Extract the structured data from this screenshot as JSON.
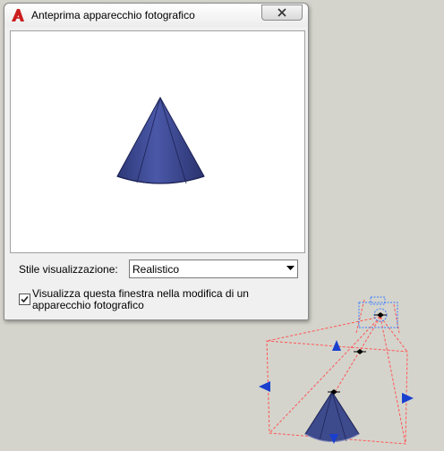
{
  "dialog": {
    "title": "Anteprima apparecchio fotografico",
    "style_label": "Stile visualizzazione:",
    "style_value": "Realistico",
    "checkbox_label": "Visualizza questa finestra nella modifica di un apparecchio fotografico",
    "checkbox_checked": true
  },
  "colors": {
    "cone": "#3d4a8c",
    "camera_frustum": "#ff5555",
    "camera_glyph": "#3a7bff",
    "grip": "#1a3fcf",
    "app_icon": "#cc1f1f"
  },
  "icons": {
    "app": "autocad-a-icon",
    "close": "close-icon",
    "dropdown": "chevron-down-icon",
    "check": "checkmark-icon",
    "camera": "camera-icon"
  }
}
